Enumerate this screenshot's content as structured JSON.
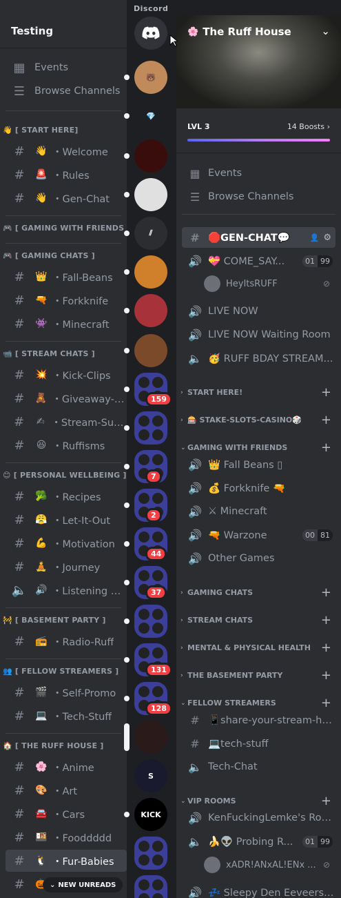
{
  "rail": {
    "title": "Discord",
    "home_icon": "discord-logo-icon",
    "servers": [
      {
        "name": "server-bear",
        "color": "#c08a5a",
        "label": "🐻"
      },
      {
        "name": "server-diamond",
        "color": "#1e1f22",
        "label": "💎"
      },
      {
        "name": "server-red-logo",
        "color": "#3a0d0d",
        "label": ""
      },
      {
        "name": "server-cartoon-face",
        "color": "#e0e0e0",
        "label": ""
      },
      {
        "name": "server-stripes",
        "color": "#2b2d31",
        "label": "⫽"
      },
      {
        "name": "server-man-orange",
        "color": "#d07f2a",
        "label": ""
      },
      {
        "name": "server-car-red",
        "color": "#a8323a",
        "label": ""
      },
      {
        "name": "server-man-fire",
        "color": "#7a4a2a",
        "label": ""
      },
      {
        "name": "folder-1",
        "badge": "159"
      },
      {
        "name": "folder-2",
        "badge": ""
      },
      {
        "name": "folder-3",
        "badge": "7"
      },
      {
        "name": "folder-4",
        "badge": "2"
      },
      {
        "name": "folder-5",
        "badge": "44"
      },
      {
        "name": "folder-6",
        "badge": "37"
      },
      {
        "name": "folder-7",
        "badge": ""
      },
      {
        "name": "folder-8",
        "badge": "131"
      },
      {
        "name": "folder-9",
        "badge": "128"
      },
      {
        "name": "server-person-dark",
        "color": "#2a1a1a",
        "label": ""
      },
      {
        "name": "server-neon",
        "color": "#1a1a2e",
        "label": "S"
      },
      {
        "name": "server-kick",
        "color": "#000000",
        "label": "KICK"
      },
      {
        "name": "folder-10",
        "badge": ""
      },
      {
        "name": "folder-11",
        "badge": ""
      }
    ]
  },
  "left": {
    "server_name": "Testing",
    "top_items": [
      {
        "icon": "calendar-icon",
        "glyph": "▦",
        "label": "Events"
      },
      {
        "icon": "browse-icon",
        "glyph": "☰",
        "label": "Browse Channels"
      }
    ],
    "categories": [
      {
        "label": "👋 [ START HERE]",
        "channels": [
          {
            "emoji": "👋",
            "label": "・Welcome"
          },
          {
            "emoji": "🚨",
            "label": "・Rules",
            "icon": "rules"
          },
          {
            "emoji": "👋",
            "label": "・Gen-Chat"
          }
        ]
      },
      {
        "label": "🎮 [ GAMING WITH FRIENDS ]",
        "channels": []
      },
      {
        "label": "🎮 [ GAMING CHATS ]",
        "channels": [
          {
            "emoji": "👑",
            "label": "・Fall-Beans"
          },
          {
            "emoji": "🔫",
            "label": "・Forkknife"
          },
          {
            "emoji": "👾",
            "label": "・Minecraft"
          }
        ]
      },
      {
        "label": "📹 [ STREAM CHATS ]",
        "channels": [
          {
            "emoji": "💥",
            "label": "・Kick-Clips"
          },
          {
            "emoji": "🧸",
            "label": "・Giveaway-F..."
          },
          {
            "emoji": "✍",
            "label": "・Stream-Sug..."
          },
          {
            "emoji": "😆",
            "label": "・Ruffisms"
          }
        ]
      },
      {
        "label": "😊 [ PERSONAL WELLBEING ]",
        "channels": [
          {
            "emoji": "🥦",
            "label": "・Recipes"
          },
          {
            "emoji": "😤",
            "label": "・Let-It-Out"
          },
          {
            "emoji": "💪",
            "label": "・Motivation"
          },
          {
            "emoji": "🧘",
            "label": "・Journey"
          },
          {
            "emoji": "🔊",
            "label": "・Listening Ear",
            "voice": true
          }
        ]
      },
      {
        "label": "🚧 [ BASEMENT PARTY ]",
        "channels": [
          {
            "emoji": "📻",
            "label": "・Radio-Ruff"
          }
        ]
      },
      {
        "label": "👥 [ FELLOW STREAMERS ]",
        "channels": [
          {
            "emoji": "🎬",
            "label": "・Self-Promo"
          },
          {
            "emoji": "💻",
            "label": "・Tech-Stuff"
          }
        ]
      },
      {
        "label": "🏠 [ THE RUFF HOUSE ]",
        "channels": [
          {
            "emoji": "🌸",
            "label": "・Anime"
          },
          {
            "emoji": "🎨",
            "label": "・Art"
          },
          {
            "emoji": "🚘",
            "label": "・Cars"
          },
          {
            "emoji": "🍱",
            "label": "・Fooddddd"
          },
          {
            "emoji": "🐧",
            "label": "・Fur-Babies",
            "active": true
          },
          {
            "emoji": "🎃",
            "label": ""
          }
        ]
      }
    ],
    "new_unreads": "NEW UNREADS"
  },
  "right": {
    "server_name": "The Ruff House",
    "boost_level": "LVL 3",
    "boost_count": "14 Boosts",
    "top_items": [
      {
        "icon": "calendar-icon",
        "glyph": "▦",
        "label": "Events"
      },
      {
        "icon": "browse-icon",
        "glyph": "☰",
        "label": "Browse Channels"
      }
    ],
    "channels_top": [
      {
        "type": "text",
        "label": "🛑GEN-CHAT💬",
        "active": true
      },
      {
        "type": "voice",
        "label": "💝 COME_SAY...",
        "count": [
          "01",
          "99"
        ]
      },
      {
        "type": "user",
        "label": "HeyItsRUFF"
      },
      {
        "type": "voice",
        "label": "LIVE NOW"
      },
      {
        "type": "voice",
        "label": "LIVE NOW Waiting Room"
      },
      {
        "type": "speaker",
        "label": "🥳 RUFF BDAY STREAM..."
      }
    ],
    "cat_start": "START HERE!",
    "cat_stake": "🎰 STAKE-SLOTS-CASINO🎲",
    "cat_gwf": "GAMING WITH FRIENDS",
    "gwf_channels": [
      {
        "label": "👑 Fall Beans ▯"
      },
      {
        "label": "💰 Forkknife 🔫"
      },
      {
        "label": "⚔ Minecraft"
      },
      {
        "label": "🔫 Warzone",
        "count": [
          "00",
          "81"
        ]
      },
      {
        "label": "Other Games"
      }
    ],
    "cat_gaming_chats": "GAMING CHATS",
    "cat_stream_chats": "STREAM CHATS",
    "cat_mental": "MENTAL & PHYSICAL HEALTH",
    "cat_basement": "THE BASEMENT PARTY",
    "cat_fellow": "FELLOW STREAMERS",
    "fellow_channels": [
      {
        "type": "text",
        "label": "📱share-your-stream-he..."
      },
      {
        "type": "text",
        "label": "💻tech-stuff"
      },
      {
        "type": "speaker",
        "label": "Tech-Chat"
      }
    ],
    "cat_vip": "VIP ROOMS",
    "vip_channels": [
      {
        "type": "voice",
        "label": "KenFuckingLemke's Room"
      },
      {
        "type": "speaker",
        "label": "🍌👽 Probing R...",
        "count": [
          "01",
          "99"
        ]
      },
      {
        "type": "user",
        "label": "xADR!ANxAL!ENx ..."
      },
      {
        "type": "voice",
        "label": "💤 Sleepy Den Eeveers ..."
      }
    ]
  }
}
